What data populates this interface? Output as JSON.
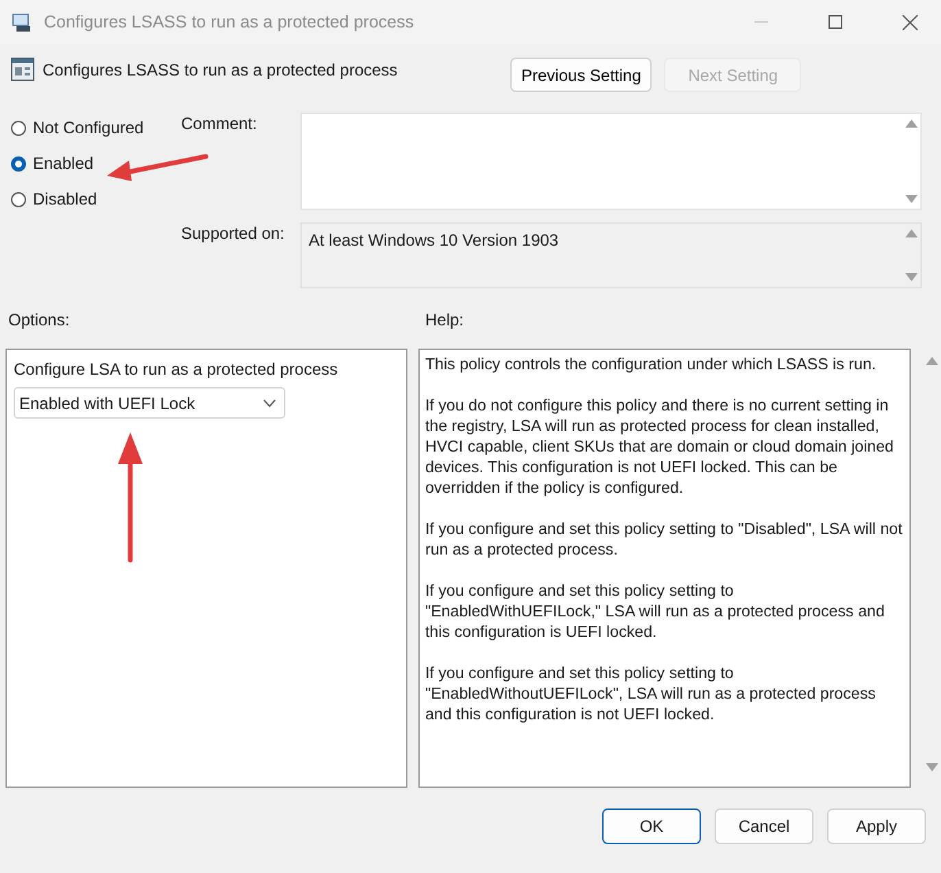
{
  "window": {
    "title": "Configures LSASS to run as a protected process"
  },
  "header": {
    "title": "Configures LSASS to run as a protected process"
  },
  "nav_buttons": [
    {
      "label": "Previous Setting",
      "disabled": false
    },
    {
      "label": "Next Setting",
      "disabled": true
    }
  ],
  "state_options": [
    {
      "label": "Not Configured",
      "selected": false
    },
    {
      "label": "Enabled",
      "selected": true
    },
    {
      "label": "Disabled",
      "selected": false
    }
  ],
  "comment": {
    "label": "Comment:"
  },
  "supported_on": {
    "label": "Supported on:",
    "value": "At least Windows 10 Version 1903"
  },
  "options": {
    "label": "Options:",
    "setting_label": "Configure LSA to run as a protected process",
    "dropdown_value": "Enabled with UEFI Lock"
  },
  "help": {
    "label": "Help:",
    "paragraphs": [
      "This policy controls the configuration under which LSASS is run.",
      "If you do not configure this policy and there is no current setting in the registry, LSA will run as protected process for clean installed, HVCI capable, client SKUs that are domain or cloud domain joined devices. This configuration is not UEFI locked. This can be overridden if the policy is configured.",
      "If you configure and set this policy setting to \"Disabled\", LSA will not run as a protected process.",
      "If you configure and set this policy setting to \"EnabledWithUEFILock,\" LSA will run as a protected process and this configuration is UEFI locked.",
      "If you configure and set this policy setting to \"EnabledWithoutUEFILock\", LSA will run as a protected process and this configuration is not UEFI locked."
    ]
  },
  "buttons": [
    {
      "label": "OK",
      "default": true
    },
    {
      "label": "Cancel",
      "default": false
    },
    {
      "label": "Apply",
      "default": false
    }
  ]
}
